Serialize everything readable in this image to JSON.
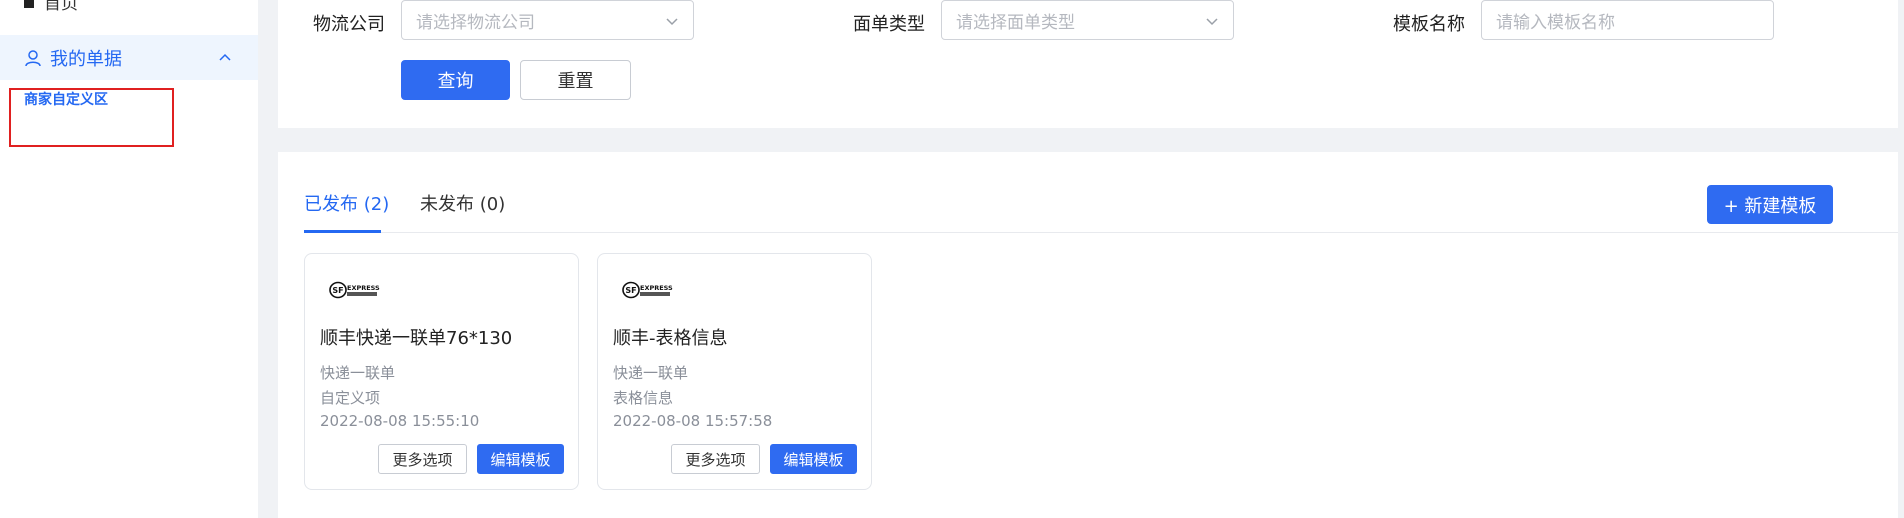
{
  "sidebar": {
    "home_label": "首页",
    "group_label": "我的单据",
    "sub_item_label": "商家自定义区"
  },
  "filters": {
    "logistics_label": "物流公司",
    "logistics_placeholder": "请选择物流公司",
    "sheet_type_label": "面单类型",
    "sheet_type_placeholder": "请选择面单类型",
    "template_name_label": "模板名称",
    "template_name_placeholder": "请输入模板名称",
    "query_button": "查询",
    "reset_button": "重置"
  },
  "tabs": {
    "published": "已发布 (2)",
    "unpublished": "未发布 (0)"
  },
  "new_template_button": "+ 新建模板",
  "cards": [
    {
      "logo": "sf-express-logo",
      "logo_text": "SF EXPRESS 顺丰速运",
      "title": "顺丰快递一联单76*130",
      "type": "快递一联单",
      "subtype": "自定义项",
      "time": "2022-08-08 15:55:10",
      "more_label": "更多选项",
      "edit_label": "编辑模板"
    },
    {
      "logo": "sf-express-logo",
      "logo_text": "SF EXPRESS 顺丰速运",
      "title": "顺丰-表格信息",
      "type": "快递一联单",
      "subtype": "表格信息",
      "time": "2022-08-08 15:57:58",
      "more_label": "更多选项",
      "edit_label": "编辑模板"
    }
  ],
  "colors": {
    "accent": "#2468f2",
    "primary_button": "#2f6bf1",
    "highlight_box": "#e02020",
    "nav_active_bg": "#eef5fe"
  }
}
